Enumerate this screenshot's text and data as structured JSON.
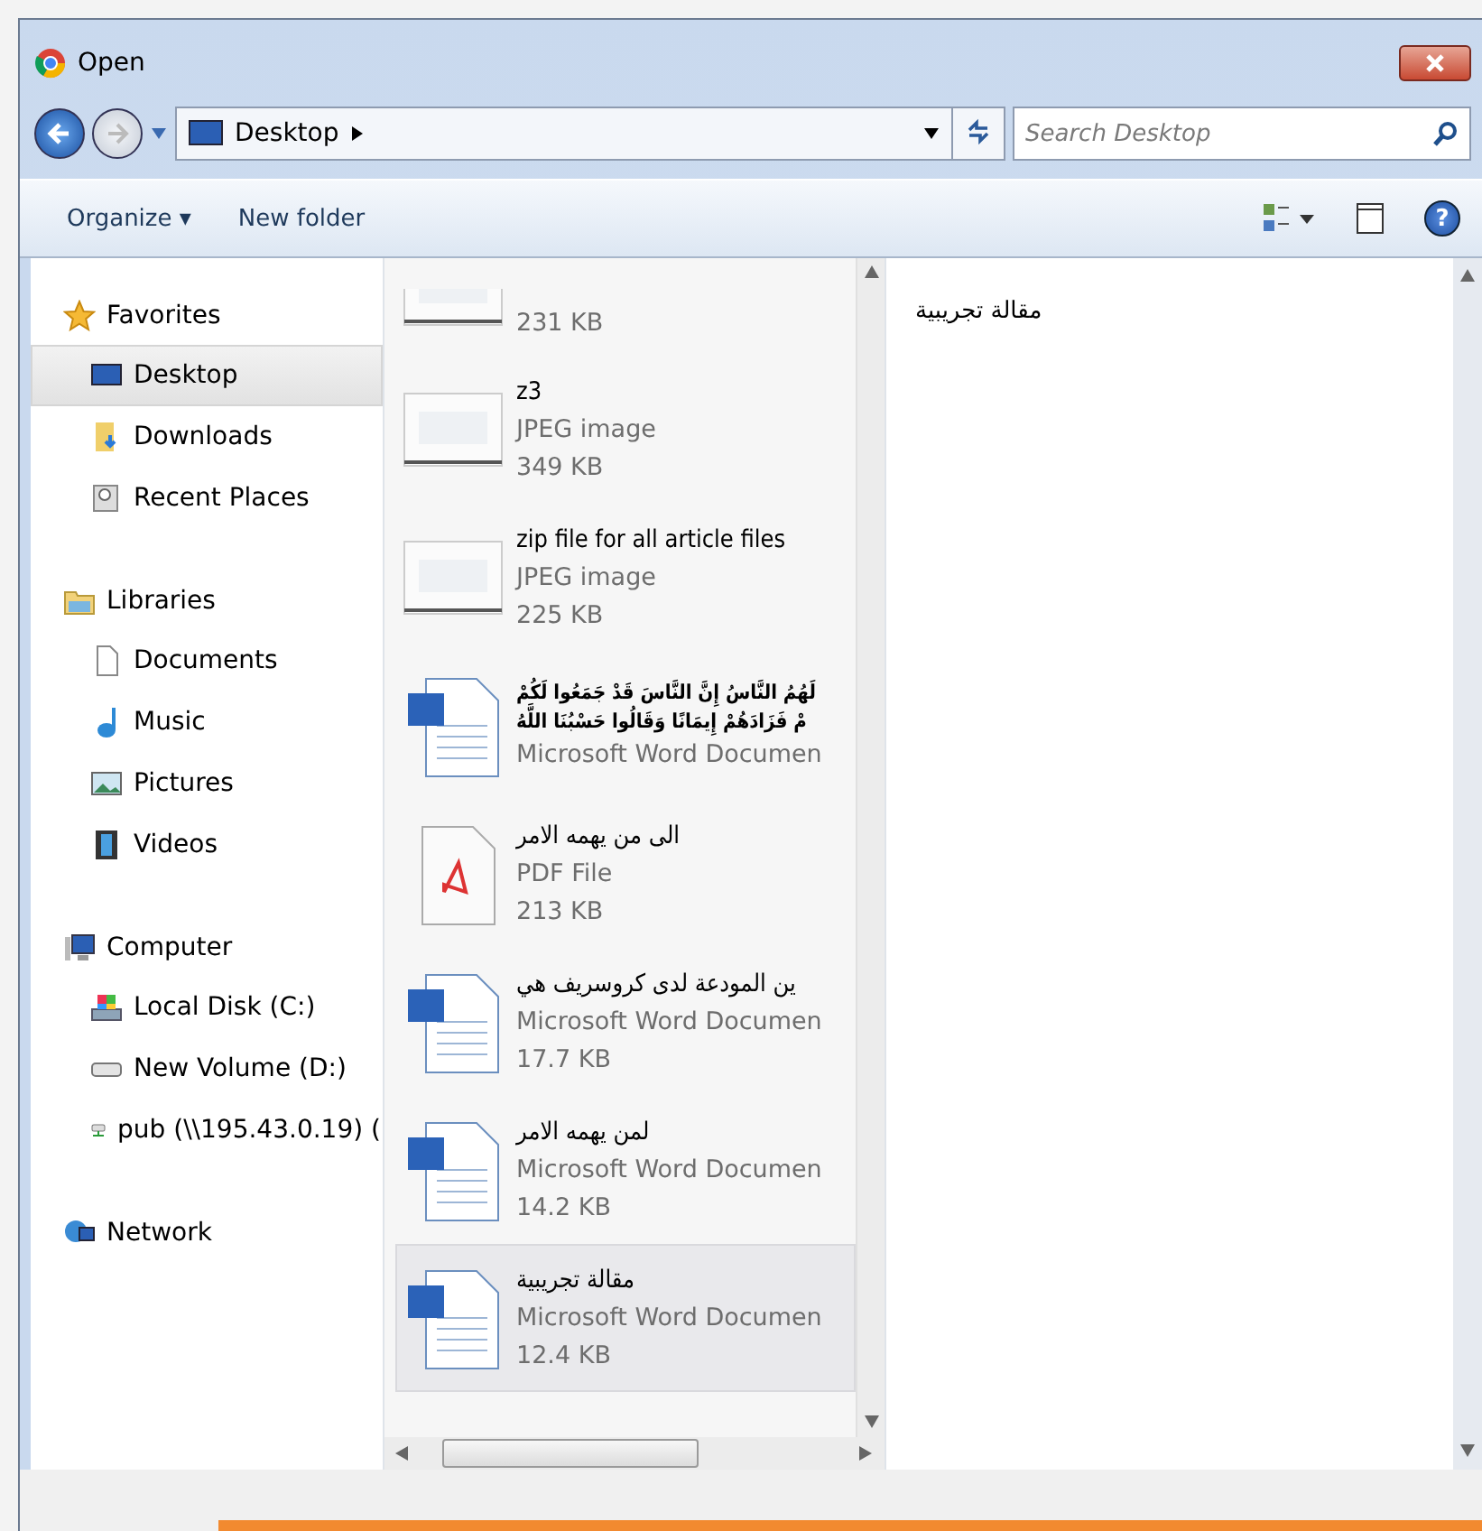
{
  "window": {
    "title": "Open"
  },
  "address": {
    "location": "Desktop",
    "search_placeholder": "Search Desktop"
  },
  "toolbar": {
    "buttons": [
      "Organize ▾",
      "New folder"
    ],
    "help": "?"
  },
  "sidebar": {
    "groups": [
      {
        "label": "Favorites",
        "items": [
          {
            "label": "Desktop",
            "selected": true
          },
          {
            "label": "Downloads",
            "selected": false
          },
          {
            "label": "Recent Places",
            "selected": false
          }
        ]
      },
      {
        "label": "Libraries",
        "items": [
          {
            "label": "Documents",
            "selected": false
          },
          {
            "label": "Music",
            "selected": false
          },
          {
            "label": "Pictures",
            "selected": false
          },
          {
            "label": "Videos",
            "selected": false
          }
        ]
      },
      {
        "label": "Computer",
        "items": [
          {
            "label": "Local Disk (C:)",
            "selected": false
          },
          {
            "label": "New Volume (D:)",
            "selected": false
          },
          {
            "label": "pub (\\\\195.43.0.19) (",
            "selected": false
          }
        ]
      },
      {
        "label": "Network"
      }
    ]
  },
  "files": [
    {
      "kind": "image",
      "size": "231 KB",
      "selected": false
    },
    {
      "kind": "image",
      "lines": [
        "z3"
      ],
      "type": "JPEG image",
      "size": "349 KB",
      "selected": false
    },
    {
      "kind": "image",
      "lines": [
        "zip file for all article files"
      ],
      "type": "JPEG image",
      "size": "225 KB",
      "selected": false
    },
    {
      "kind": "word",
      "lines": [
        "لَهُمُ النَّاسُ إِنَّ النَّاسَ قَدْ جَمَعُوا لَكُمْ",
        "مْ فَزَادَهُمْ إِيمَانًا وَقَالُوا حَسْبُنَا اللَّهُ"
      ],
      "type": "Microsoft Word Documen",
      "selected": false
    },
    {
      "kind": "pdf",
      "lines": [
        "الى من يهمه الامر"
      ],
      "type": "PDF File",
      "size": "213 KB",
      "selected": false
    },
    {
      "kind": "word",
      "lines": [
        "ين المودعة لدى كروسريف هي"
      ],
      "type": "Microsoft Word Documen",
      "size": "17.7 KB",
      "selected": false
    },
    {
      "kind": "word",
      "lines": [
        "لمن يهمه الامر"
      ],
      "type": "Microsoft Word Documen",
      "size": "14.2 KB",
      "selected": false
    },
    {
      "kind": "word",
      "lines": [
        "مقالة تجريبية"
      ],
      "type": "Microsoft Word Documen",
      "size": "12.4 KB",
      "selected": true
    }
  ],
  "preview": {
    "text": "مقالة تجريبية"
  }
}
